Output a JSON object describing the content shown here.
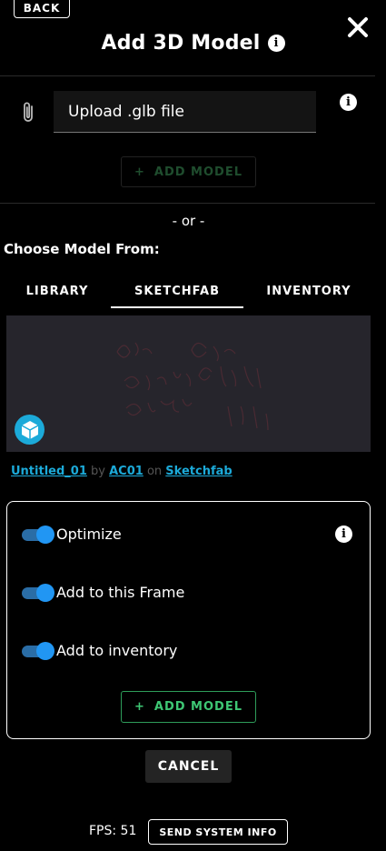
{
  "header": {
    "back_label": "BACK",
    "title": "Add 3D Model",
    "info_glyph": "i",
    "close_icon": "close-icon"
  },
  "upload": {
    "value": "Upload .glb file",
    "info_glyph": "i",
    "add_label": "ADD MODEL",
    "add_glyph": "+"
  },
  "or_text": "- or -",
  "choose_label": "Choose Model From:",
  "tabs": [
    {
      "label": "LIBRARY",
      "active": false
    },
    {
      "label": "SKETCHFAB",
      "active": true
    },
    {
      "label": "INVENTORY",
      "active": false
    }
  ],
  "model": {
    "name": "Untitled_01",
    "by": "by",
    "author": "AC01",
    "on": "on",
    "source": "Sketchfab"
  },
  "options": {
    "optimize_label": "Optimize",
    "optimize_on": true,
    "frame_label": "Add to this Frame",
    "frame_on": true,
    "inventory_label": "Add to inventory",
    "inventory_on": true,
    "info_glyph": "i",
    "add_label": "ADD MODEL",
    "add_glyph": "+"
  },
  "cancel_label": "CANCEL",
  "footer": {
    "fps": "FPS: 51",
    "send_label": "SEND SYSTEM INFO"
  },
  "colors": {
    "accent_blue": "#2196f3",
    "sketchfab_blue": "#1caad9",
    "add_green": "#3ec774"
  }
}
